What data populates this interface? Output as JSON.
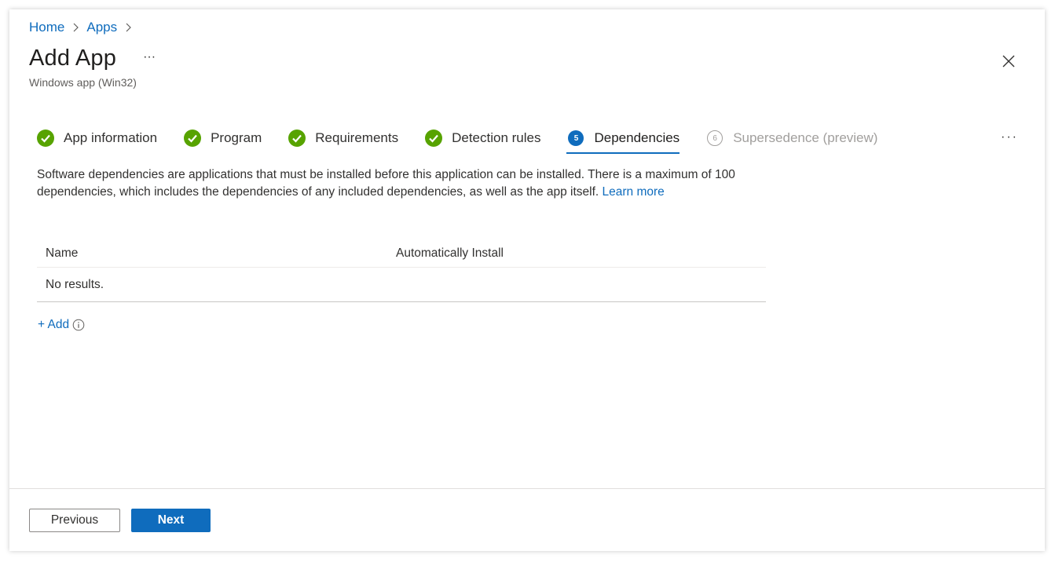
{
  "breadcrumb": {
    "items": [
      "Home",
      "Apps"
    ]
  },
  "header": {
    "title": "Add App",
    "more_label": "···",
    "subtitle": "Windows app (Win32)"
  },
  "wizard": {
    "steps": [
      {
        "label": "App information",
        "state": "complete"
      },
      {
        "label": "Program",
        "state": "complete"
      },
      {
        "label": "Requirements",
        "state": "complete"
      },
      {
        "label": "Detection rules",
        "state": "complete"
      },
      {
        "label": "Dependencies",
        "state": "active",
        "number": "5"
      },
      {
        "label": "Supersedence (preview)",
        "state": "disabled",
        "number": "6"
      }
    ],
    "more_label": "···"
  },
  "main": {
    "description": "Software dependencies are applications that must be installed before this application can be installed. There is a maximum of 100 dependencies, which includes the dependencies of any included dependencies, as well as the app itself.",
    "learn_more": "Learn more",
    "table": {
      "columns": [
        "Name",
        "Automatically Install"
      ],
      "empty_text": "No results."
    },
    "add_label": "+ Add"
  },
  "footer": {
    "previous_label": "Previous",
    "next_label": "Next"
  },
  "colors": {
    "accent": "#0f6cbd",
    "success": "#57a300",
    "disabled": "#a19f9d"
  }
}
